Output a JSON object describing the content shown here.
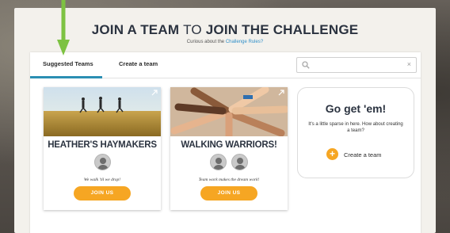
{
  "header": {
    "title_bold_1": "JOIN A TEAM",
    "title_light": "TO",
    "title_bold_2": "JOIN THE CHALLENGE",
    "subtitle_prefix": "Curious about the",
    "subtitle_link": "Challenge Rules?"
  },
  "tabs": [
    {
      "label": "Suggested Teams",
      "active": true
    },
    {
      "label": "Create a team",
      "active": false
    }
  ],
  "search": {
    "placeholder": "",
    "value": "",
    "clear_glyph": "×"
  },
  "teams": [
    {
      "name": "HEATHER'S HAYMAKERS",
      "members": 1,
      "motto": "We walk 'til we drop!",
      "join_label": "JOIN US"
    },
    {
      "name": "WALKING WARRIORS!",
      "members": 2,
      "motto": "Team work makes the dream work!",
      "join_label": "JOIN US"
    }
  ],
  "empty_state": {
    "title": "Go get 'em!",
    "text": "It's a little sparse in here. How about creating a team?",
    "create_label": "Create a team",
    "plus_glyph": "+"
  },
  "colors": {
    "accent": "#f6a623",
    "tab_underline": "#2b8fb3",
    "heading": "#2b3340",
    "link": "#2f8fc8",
    "annotation_arrow": "#7dc242"
  },
  "icons": {
    "search": "search-icon",
    "clear": "close-icon",
    "plus": "plus-circle-icon",
    "avatar": "user-avatar-icon",
    "arrow": "down-arrow-icon"
  }
}
